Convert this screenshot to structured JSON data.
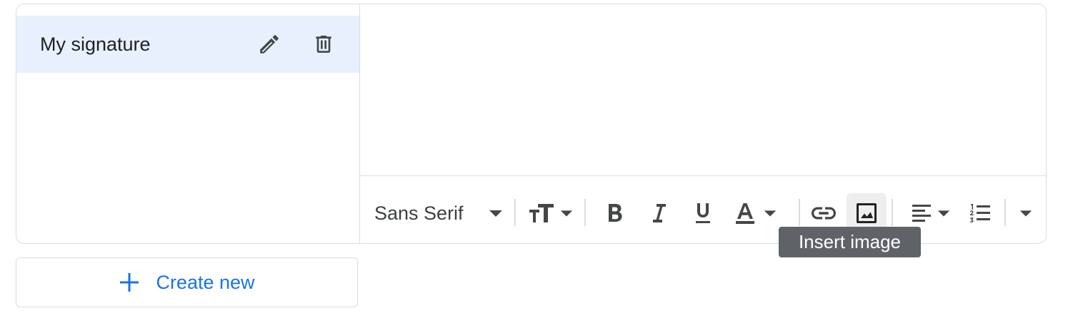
{
  "signatures": {
    "items": [
      {
        "label": "My signature"
      }
    ]
  },
  "toolbar": {
    "font_family": "Sans Serif",
    "icons": {
      "font_dropdown": "arrow-drop-down-icon",
      "text_size": "text-size-icon",
      "bold": "format-bold-icon",
      "italic": "format-italic-icon",
      "underline": "format-underline-icon",
      "text_color": "text-color-icon",
      "link": "link-icon",
      "image": "insert-image-icon",
      "align": "align-left-icon",
      "numbered_list": "numbered-list-icon",
      "more": "arrow-drop-down-icon"
    },
    "active_item": "insert-image"
  },
  "tooltip": {
    "text": "Insert image"
  },
  "create": {
    "label": "Create new"
  },
  "colors": {
    "accent": "#1a73e8",
    "selected_row": "#e8f0fe",
    "border": "#dadce0",
    "icon": "#444746",
    "tooltip_bg": "#5f6368"
  }
}
